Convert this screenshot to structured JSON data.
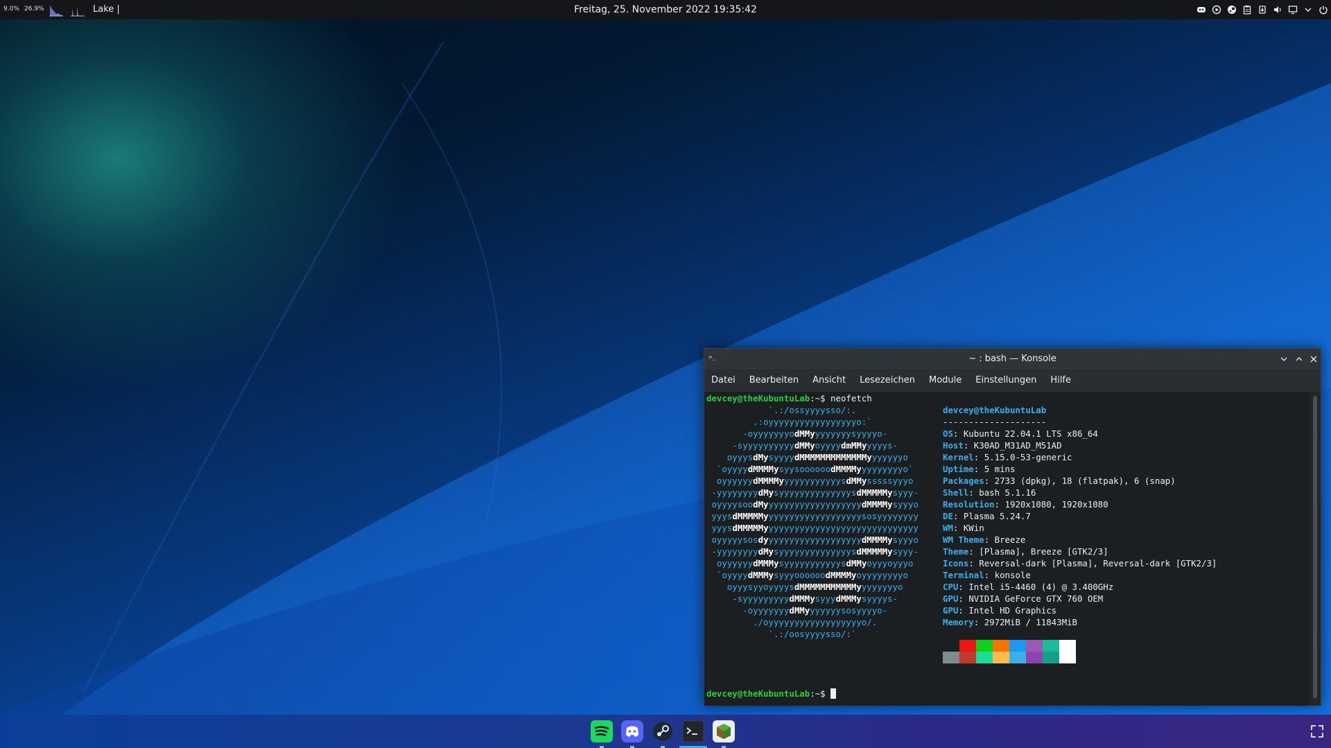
{
  "top_panel": {
    "cpu_percent": "9.0%",
    "mem_percent": "26.9%",
    "window_title": "Lake |",
    "clock": "Freitag, 25. November 2022 19:35:42"
  },
  "konsole": {
    "title": "~ : bash — Konsole",
    "menu": [
      "Datei",
      "Bearbeiten",
      "Ansicht",
      "Lesezeichen",
      "Module",
      "Einstellungen",
      "Hilfe"
    ],
    "prompt_user": "devcey@theKubuntuLab",
    "prompt_path": ":~$",
    "command": " neofetch",
    "logo": [
      [
        [
          "d",
          "            `.:/ossyyyysso/:."
        ]
      ],
      [
        [
          "d",
          "         .:oyyyyyyyyyyyyyyyyyo:`"
        ]
      ],
      [
        [
          "d",
          "       -oyyyyyyyo"
        ],
        [
          "b",
          "dMMy"
        ],
        [
          "d",
          "yyyyyyysyyyyo-"
        ]
      ],
      [
        [
          "d",
          "     -syyyyyyyyyy"
        ],
        [
          "b",
          "dMMy"
        ],
        [
          "d",
          "oyyyy"
        ],
        [
          "b",
          "dmMMy"
        ],
        [
          "d",
          "yyyys-"
        ]
      ],
      [
        [
          "d",
          "    oyyys"
        ],
        [
          "b",
          "dMy"
        ],
        [
          "d",
          "syyyy"
        ],
        [
          "b",
          "dMMMMMMMMMMMMMy"
        ],
        [
          "d",
          "yyyyyyo"
        ]
      ],
      [
        [
          "d",
          "  `oyyyy"
        ],
        [
          "b",
          "dMMMMy"
        ],
        [
          "d",
          "syysoooooo"
        ],
        [
          "b",
          "dMMMMy"
        ],
        [
          "d",
          "yyyyyyyyo`"
        ]
      ],
      [
        [
          "d",
          "  oyyyyyy"
        ],
        [
          "b",
          "dMMMMy"
        ],
        [
          "d",
          "yyyyyyyyyyys"
        ],
        [
          "b",
          "dMMy"
        ],
        [
          "d",
          "sssssyyyo"
        ]
      ],
      [
        [
          "d",
          " -yyyyyyyy"
        ],
        [
          "b",
          "dMy"
        ],
        [
          "d",
          "syyyyyyyyyyyyyys"
        ],
        [
          "b",
          "dMMMMMy"
        ],
        [
          "d",
          "syyy-"
        ]
      ],
      [
        [
          "d",
          " oyyyysoo"
        ],
        [
          "b",
          "dMy"
        ],
        [
          "d",
          "yyyyyyyyyyyyyyyyyy"
        ],
        [
          "b",
          "dMMMMy"
        ],
        [
          "d",
          "syyyo"
        ]
      ],
      [
        [
          "d",
          " yyys"
        ],
        [
          "b",
          "dMMMMMy"
        ],
        [
          "d",
          "yyyyyyyyyyyyyyyyyysosyyyyyyyy"
        ]
      ],
      [
        [
          "d",
          " yyys"
        ],
        [
          "b",
          "dMMMMMy"
        ],
        [
          "d",
          "yyyyyyyyyyyyyyyyyyyyyyyyyyyyy"
        ]
      ],
      [
        [
          "d",
          " oyyyyysos"
        ],
        [
          "b",
          "dy"
        ],
        [
          "d",
          "yyyyyyyyyyyyyyyyyy"
        ],
        [
          "b",
          "dMMMMy"
        ],
        [
          "d",
          "syyyo"
        ]
      ],
      [
        [
          "d",
          " -yyyyyyyy"
        ],
        [
          "b",
          "dMy"
        ],
        [
          "d",
          "syyyyyyyyyyyyyys"
        ],
        [
          "b",
          "dMMMMMy"
        ],
        [
          "d",
          "syyy-"
        ]
      ],
      [
        [
          "d",
          "  oyyyyyy"
        ],
        [
          "b",
          "dMMMy"
        ],
        [
          "d",
          "syyyyyyyyyyys"
        ],
        [
          "b",
          "dMMy"
        ],
        [
          "d",
          "oyyyoyyyo"
        ]
      ],
      [
        [
          "d",
          "  `oyyyy"
        ],
        [
          "b",
          "dMMMy"
        ],
        [
          "d",
          "syyyoooooo"
        ],
        [
          "b",
          "dMMMMy"
        ],
        [
          "d",
          "oyyyyyyyyo"
        ]
      ],
      [
        [
          "d",
          "    oyyysyyoyyyys"
        ],
        [
          "b",
          "dMMMMMMMMMMMy"
        ],
        [
          "d",
          "yyyyyyyo"
        ]
      ],
      [
        [
          "d",
          "     -syyyyyyyyy"
        ],
        [
          "b",
          "dMMMy"
        ],
        [
          "d",
          "syyy"
        ],
        [
          "b",
          "dMMMy"
        ],
        [
          "d",
          "syyyys-"
        ]
      ],
      [
        [
          "d",
          "       -oyyyyyyy"
        ],
        [
          "b",
          "dMMy"
        ],
        [
          "d",
          "yyyyyysosyyyyo-"
        ]
      ],
      [
        [
          "d",
          "         ./oyyyyyyyyyyyyyyyyyyo/."
        ]
      ],
      [
        [
          "d",
          "            `.:/oosyyyysso/:`"
        ]
      ]
    ],
    "info_title": "devcey@theKubuntuLab",
    "info_rule": "--------------------",
    "info": [
      {
        "key": "OS",
        "value": "Kubuntu 22.04.1 LTS x86_64"
      },
      {
        "key": "Host",
        "value": "K30AD_M31AD_M51AD"
      },
      {
        "key": "Kernel",
        "value": "5.15.0-53-generic"
      },
      {
        "key": "Uptime",
        "value": "5 mins"
      },
      {
        "key": "Packages",
        "value": "2733 (dpkg), 18 (flatpak), 6 (snap)"
      },
      {
        "key": "Shell",
        "value": "bash 5.1.16"
      },
      {
        "key": "Resolution",
        "value": "1920x1080, 1920x1080"
      },
      {
        "key": "DE",
        "value": "Plasma 5.24.7"
      },
      {
        "key": "WM",
        "value": "KWin"
      },
      {
        "key": "WM Theme",
        "value": "Breeze"
      },
      {
        "key": "Theme",
        "value": "[Plasma], Breeze [GTK2/3]"
      },
      {
        "key": "Icons",
        "value": "Reversal-dark [Plasma], Reversal-dark [GTK2/3]"
      },
      {
        "key": "Terminal",
        "value": "konsole"
      },
      {
        "key": "CPU",
        "value": "Intel i5-4460 (4) @ 3.400GHz"
      },
      {
        "key": "GPU",
        "value": "NVIDIA GeForce GTX 760 OEM"
      },
      {
        "key": "GPU",
        "value": "Intel HD Graphics"
      },
      {
        "key": "Memory",
        "value": "2972MiB / 11843MiB"
      }
    ],
    "palette_top": [
      "#1c1f22",
      "#ed1515",
      "#11d116",
      "#f67400",
      "#1d99f3",
      "#9b59b6",
      "#1abc9c",
      "#ffffff"
    ],
    "palette_bottom": [
      "#7f8c8d",
      "#c0392b",
      "#1cdc9a",
      "#fdbc4b",
      "#3daee9",
      "#8e44ad",
      "#16a085",
      "#ffffff"
    ]
  },
  "taskbar": {
    "apps": [
      {
        "name": "spotify",
        "color": "#1ed760"
      },
      {
        "name": "discord",
        "color": "#5865f2"
      },
      {
        "name": "steam",
        "color": "#eceff1"
      },
      {
        "name": "konsole",
        "color": "#232629"
      },
      {
        "name": "minecraft",
        "color": "#5aa83a"
      }
    ],
    "active_app": "konsole"
  }
}
